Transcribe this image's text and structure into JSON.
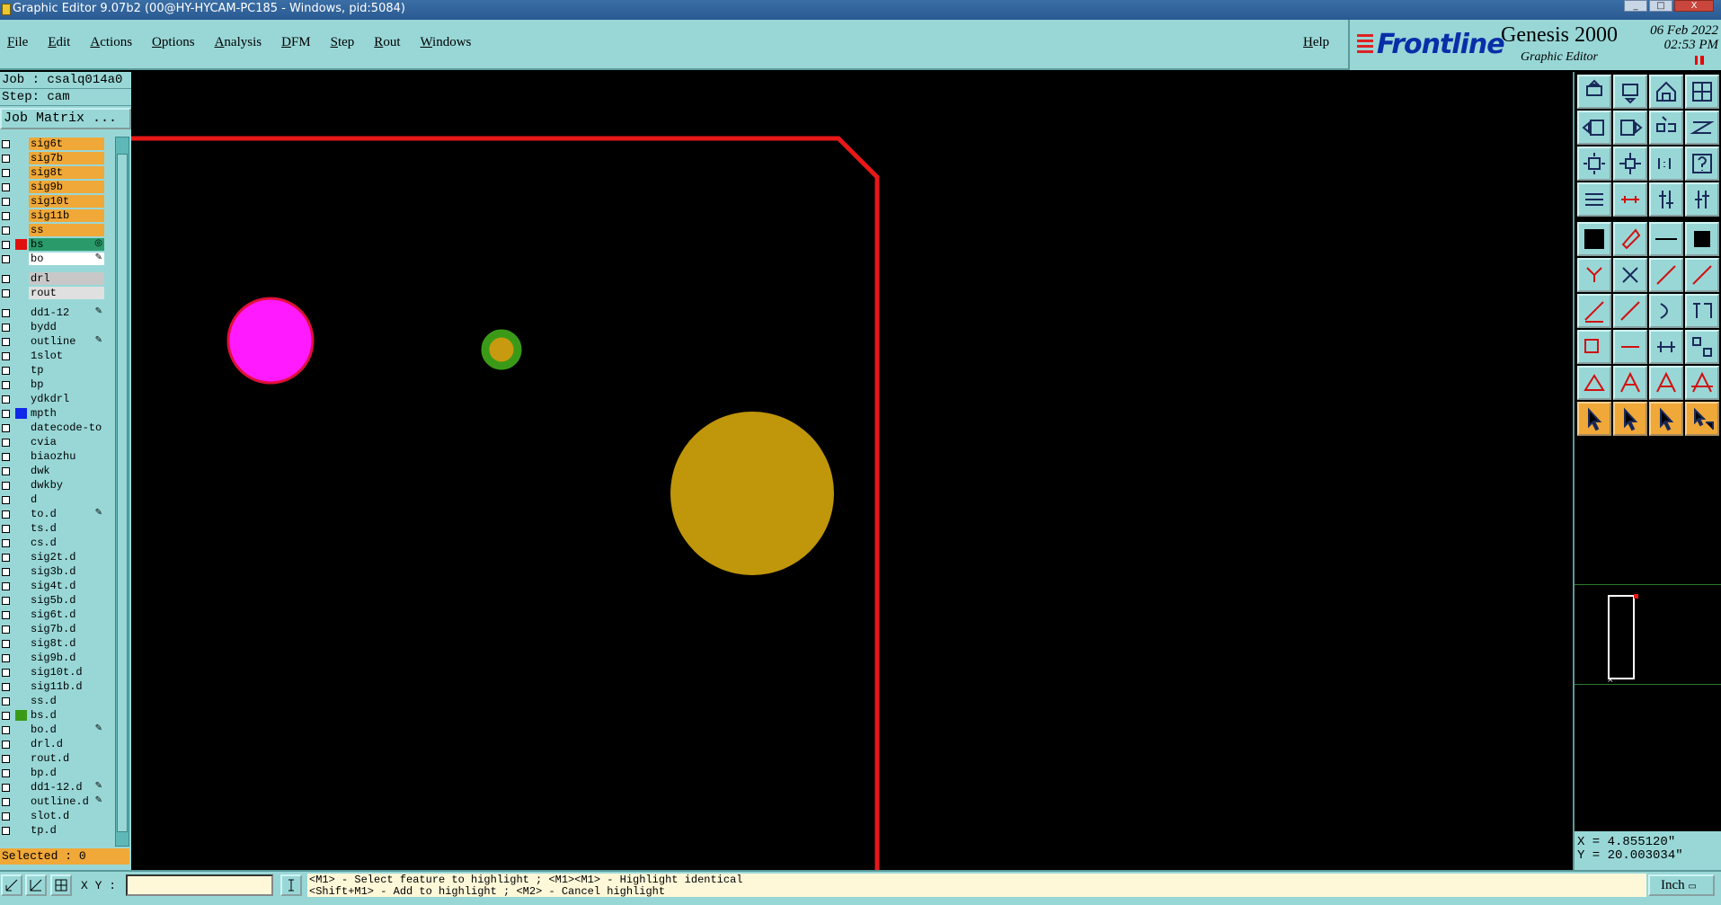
{
  "window": {
    "title": "Graphic Editor 9.07b2 (00@HY-HYCAM-PC185 - Windows, pid:5084)",
    "buttons": [
      "_",
      "□",
      "X"
    ]
  },
  "menu": {
    "items": [
      "File",
      "Edit",
      "Actions",
      "Options",
      "Analysis",
      "DFM",
      "Step",
      "Rout",
      "Windows"
    ],
    "help": "Help"
  },
  "brand": {
    "logo": "Frontline",
    "product": "Genesis 2000",
    "subtitle": "Graphic Editor",
    "date": "06 Feb 2022",
    "time": "02:53 PM"
  },
  "job": {
    "job_line": "Job : csalq014a0",
    "step_line": "Step: cam",
    "matrix_button": "Job Matrix ..."
  },
  "layers": [
    {
      "name": "sig6t",
      "bg": "#f0a838"
    },
    {
      "name": "sig7b",
      "bg": "#f0a838"
    },
    {
      "name": "sig8t",
      "bg": "#f0a838"
    },
    {
      "name": "sig9b",
      "bg": "#f0a838"
    },
    {
      "name": "sig10t",
      "bg": "#f0a838"
    },
    {
      "name": "sig11b",
      "bg": "#f0a838"
    },
    {
      "name": "ss",
      "bg": "#f0a838"
    },
    {
      "name": "bs",
      "bg": "#2a9a6a",
      "swatch": "#e01010",
      "marker": "◎",
      "active": true
    },
    {
      "name": "bo",
      "bg": "#ffffff",
      "marker": "✎",
      "sep_after": true
    },
    {
      "name": "drl",
      "bg": "#c8c8c8"
    },
    {
      "name": "rout",
      "bg": "#e0e0e0",
      "sep_after": true
    },
    {
      "name": "dd1-12",
      "bg": "#99d7d7",
      "marker": "✎"
    },
    {
      "name": "bydd",
      "bg": "#99d7d7"
    },
    {
      "name": "outline",
      "bg": "#99d7d7",
      "marker": "✎"
    },
    {
      "name": "1slot",
      "bg": "#99d7d7"
    },
    {
      "name": "tp",
      "bg": "#99d7d7"
    },
    {
      "name": "bp",
      "bg": "#99d7d7"
    },
    {
      "name": "ydkdrl",
      "bg": "#99d7d7"
    },
    {
      "name": "mpth",
      "bg": "#99d7d7",
      "swatch": "#1028e8"
    },
    {
      "name": "datecode-to",
      "bg": "#99d7d7"
    },
    {
      "name": "cvia",
      "bg": "#99d7d7"
    },
    {
      "name": "biaozhu",
      "bg": "#99d7d7"
    },
    {
      "name": "dwk",
      "bg": "#99d7d7"
    },
    {
      "name": "dwkby",
      "bg": "#99d7d7"
    },
    {
      "name": "d",
      "bg": "#99d7d7"
    },
    {
      "name": "to.d",
      "bg": "#99d7d7",
      "marker": "✎"
    },
    {
      "name": "ts.d",
      "bg": "#99d7d7"
    },
    {
      "name": "cs.d",
      "bg": "#99d7d7"
    },
    {
      "name": "sig2t.d",
      "bg": "#99d7d7"
    },
    {
      "name": "sig3b.d",
      "bg": "#99d7d7"
    },
    {
      "name": "sig4t.d",
      "bg": "#99d7d7"
    },
    {
      "name": "sig5b.d",
      "bg": "#99d7d7"
    },
    {
      "name": "sig6t.d",
      "bg": "#99d7d7"
    },
    {
      "name": "sig7b.d",
      "bg": "#99d7d7"
    },
    {
      "name": "sig8t.d",
      "bg": "#99d7d7"
    },
    {
      "name": "sig9b.d",
      "bg": "#99d7d7"
    },
    {
      "name": "sig10t.d",
      "bg": "#99d7d7"
    },
    {
      "name": "sig11b.d",
      "bg": "#99d7d7"
    },
    {
      "name": "ss.d",
      "bg": "#99d7d7"
    },
    {
      "name": "bs.d",
      "bg": "#99d7d7",
      "swatch": "#3a9a18"
    },
    {
      "name": "bo.d",
      "bg": "#99d7d7",
      "marker": "✎"
    },
    {
      "name": "drl.d",
      "bg": "#99d7d7"
    },
    {
      "name": "rout.d",
      "bg": "#99d7d7"
    },
    {
      "name": "bp.d",
      "bg": "#99d7d7"
    },
    {
      "name": "dd1-12.d",
      "bg": "#99d7d7",
      "marker": "✎"
    },
    {
      "name": "outline.d",
      "bg": "#99d7d7",
      "marker": "✎"
    },
    {
      "name": "slot.d",
      "bg": "#99d7d7"
    },
    {
      "name": "tp.d",
      "bg": "#99d7d7"
    }
  ],
  "selected": "Selected : 0",
  "canvas": {
    "features": [
      {
        "kind": "pad",
        "name": "magenta-pad",
        "fill": "#ff1aff",
        "stroke": "#e0103a"
      },
      {
        "kind": "pad",
        "name": "green-ring-pad",
        "fill": "#c89a10",
        "stroke": "#3a9a18"
      },
      {
        "kind": "pad",
        "name": "large-yellow-pad",
        "fill": "#c0960a"
      },
      {
        "kind": "outline",
        "name": "board-outline",
        "stroke": "#e81818"
      }
    ]
  },
  "toolbox": {
    "tools": [
      "layer-up-icon",
      "layer-down-icon",
      "home-icon",
      "window-split-icon",
      "pan-left-icon",
      "pan-right-icon",
      "undo-view-icon",
      "redo-view-icon",
      "zoom-fit-icon",
      "zoom-center-icon",
      "one-to-one-icon",
      "help-icon",
      "settings-icon",
      "measure-icon",
      "snap-icon",
      "snap-alt-icon",
      "pad-icon",
      "polygon-icon",
      "line-pattern-icon",
      "square-pad-icon",
      "connect-icon",
      "delete-node-icon",
      "add-node-icon",
      "move-node-icon",
      "line-add-icon",
      "line-edit-icon",
      "arc-icon",
      "text-icon",
      "surface-icon",
      "line-icon",
      "dimension-icon",
      "array-icon",
      "triangle-icon",
      "triangle-select-icon",
      "text-a-icon",
      "text-a-bold-icon",
      "select-arrow-icon",
      "select-arrow-box-icon",
      "select-arrow-circle-icon",
      "select-move-icon"
    ],
    "coord_x": "X = 4.855120\"",
    "coord_y": "Y = 20.003034\""
  },
  "bottom": {
    "xy_label": "X Y :",
    "xy_value": "",
    "hint_line1": "<M1> - Select feature to highlight ; <M1><M1> - Highlight identical",
    "hint_line2": "<Shift+M1> - Add to highlight ; <M2> - Cancel highlight",
    "units": "Inch"
  }
}
